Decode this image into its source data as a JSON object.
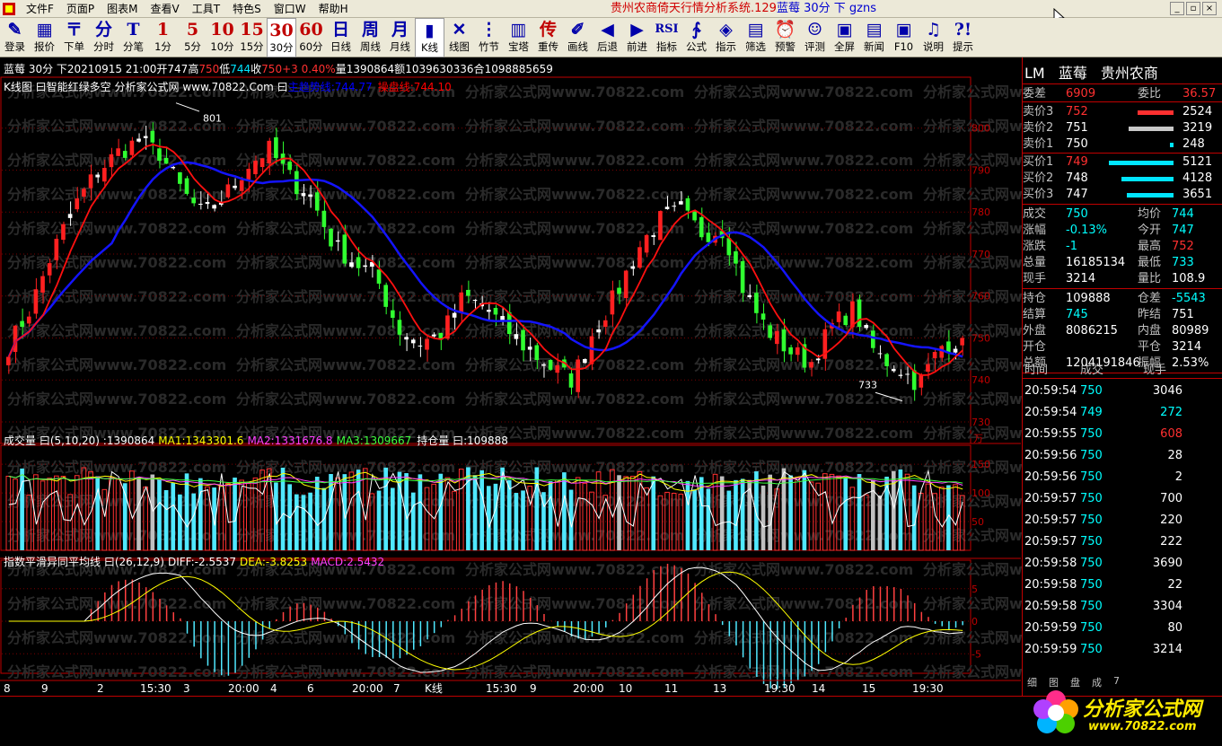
{
  "menubar": {
    "items": [
      "文件F",
      "页面P",
      "图表M",
      "查看V",
      "工具T",
      "特色S",
      "窗口W",
      "帮助H"
    ],
    "title_red": "贵州农商倚天行情分析系统.129",
    "title_blue": "蓝莓 30分 下 gzns"
  },
  "toolbar": [
    {
      "icon": "✎",
      "label": "登录",
      "name": "login"
    },
    {
      "icon": "▦",
      "label": "报价",
      "name": "quote"
    },
    {
      "icon": "〒",
      "label": "下单",
      "name": "order"
    },
    {
      "icon": "分",
      "label": "分时",
      "name": "intraday"
    },
    {
      "icon": "T",
      "label": "分笔",
      "name": "tick"
    },
    {
      "icon": "1",
      "label": "1分",
      "name": "1min"
    },
    {
      "icon": "5",
      "label": "5分",
      "name": "5min"
    },
    {
      "icon": "10",
      "label": "10分",
      "name": "10min"
    },
    {
      "icon": "15",
      "label": "15分",
      "name": "15min"
    },
    {
      "icon": "30",
      "label": "30分",
      "name": "30min",
      "selected": true
    },
    {
      "icon": "60",
      "label": "60分",
      "name": "60min"
    },
    {
      "icon": "日",
      "label": "日线",
      "name": "daily"
    },
    {
      "icon": "周",
      "label": "周线",
      "name": "weekly"
    },
    {
      "icon": "月",
      "label": "月线",
      "name": "monthly"
    },
    {
      "icon": "▮",
      "label": "K线",
      "name": "kline",
      "selected": true
    },
    {
      "icon": "✕",
      "label": "线图",
      "name": "line-chart"
    },
    {
      "icon": "⋮",
      "label": "竹节",
      "name": "bamboo"
    },
    {
      "icon": "▥",
      "label": "宝塔",
      "name": "tower"
    },
    {
      "icon": "传",
      "label": "重传",
      "name": "resend"
    },
    {
      "icon": "✐",
      "label": "画线",
      "name": "draw"
    },
    {
      "icon": "◀",
      "label": "后退",
      "name": "back"
    },
    {
      "icon": "▶",
      "label": "前进",
      "name": "forward"
    },
    {
      "icon": "RSI",
      "label": "指标",
      "name": "indicator"
    },
    {
      "icon": "∱",
      "label": "公式",
      "name": "formula"
    },
    {
      "icon": "◈",
      "label": "指示",
      "name": "signal"
    },
    {
      "icon": "▤",
      "label": "筛选",
      "name": "filter"
    },
    {
      "icon": "⏰",
      "label": "预警",
      "name": "alert"
    },
    {
      "icon": "☺",
      "label": "评测",
      "name": "evaluate"
    },
    {
      "icon": "▣",
      "label": "全屏",
      "name": "fullscreen"
    },
    {
      "icon": "▤",
      "label": "新闻",
      "name": "news"
    },
    {
      "icon": "▣",
      "label": "F10",
      "name": "f10"
    },
    {
      "icon": "♫",
      "label": "说明",
      "name": "manual"
    },
    {
      "icon": "?!",
      "label": "提示",
      "name": "tips"
    }
  ],
  "info_line": {
    "symbol": "蓝莓 30分 下",
    "datetime": "20210915 21:00",
    "open_label": "开",
    "open": "747",
    "high_label": "高",
    "high": "750",
    "low_label": "低",
    "low": "744",
    "close_label": "收",
    "close": "750",
    "change": "+3 0.40%",
    "vol_label": "量",
    "vol": "1390864",
    "amount_label": "额",
    "amount": "1039630336",
    "oi_label": "合",
    "oi": "109888",
    "extra": "5659"
  },
  "kline_panel": {
    "title": "K线图 曰智能红绿多空 分析家公式网 www.70822.Com 曰",
    "ma_blue_label": "主趋势线:744.77",
    "ma_red_label": "操盘线:744.10",
    "high_mark": "801",
    "low_mark": "733",
    "watermark": "分析家公式网www.70822.com"
  },
  "volume_panel": {
    "title": "成交量 曰(5,10,20) :1390864",
    "ma1": "MA1:1343301.6",
    "ma2": "MA2:1331676.8",
    "ma3": "MA3:1309667",
    "oi": "持仓量 曰:109888",
    "unit": "万"
  },
  "macd_panel": {
    "title": "指数平滑异同平均线 曰(26,12,9)",
    "diff": "DIFF:-2.5537",
    "dea": "DEA:-3.8253",
    "macd": "MACD:2.5432"
  },
  "x_axis": [
    "8",
    "9",
    "2",
    "15:30",
    "3",
    "20:00",
    "4",
    "6",
    "20:00",
    "7",
    "K线",
    "15:30",
    "9",
    "20:00",
    "10",
    "11",
    "13",
    "19:30",
    "14",
    "15",
    "19:30"
  ],
  "chart_data": [
    {
      "type": "candlestick",
      "ylim": [
        727,
        810
      ],
      "yticks": [
        730,
        740,
        750,
        760,
        770,
        780,
        790,
        800
      ],
      "series": [
        {
          "name": "主趋势线",
          "color": "#0000ff",
          "value": 744.77
        },
        {
          "name": "操盘线",
          "color": "#ff0000",
          "value": 744.1
        }
      ],
      "close_anchors": [
        748,
        757,
        770,
        781,
        789,
        794,
        797,
        794,
        785,
        779,
        784,
        791,
        795,
        788,
        783,
        772,
        768,
        764,
        752,
        749,
        751,
        760,
        757,
        752,
        747,
        743,
        740,
        752,
        760,
        771,
        778,
        780,
        775,
        776,
        760,
        752,
        747,
        744,
        753,
        757,
        746,
        743,
        739,
        748,
        750
      ]
    },
    {
      "type": "bar",
      "ylim": [
        0,
        180
      ],
      "yticks": [
        50,
        100,
        150
      ],
      "unit": "万",
      "series": [
        {
          "name": "成交量",
          "last": 1390864
        },
        {
          "name": "MA1",
          "last": 1343301.6
        },
        {
          "name": "MA2",
          "last": 1331676.8
        },
        {
          "name": "MA3",
          "last": 1309667
        },
        {
          "name": "持仓量",
          "last": 109888
        }
      ]
    },
    {
      "type": "bar",
      "ylim": [
        -8,
        8
      ],
      "yticks": [
        5,
        0,
        -5
      ],
      "series": [
        {
          "name": "DIFF",
          "last": -2.5537
        },
        {
          "name": "DEA",
          "last": -3.8253
        },
        {
          "name": "MACD",
          "last": 2.5432
        }
      ]
    }
  ],
  "right_panel": {
    "title": [
      "LM",
      "蓝莓",
      "贵州农商"
    ],
    "weicha": {
      "l1": "委差",
      "v1": "6909",
      "l2": "委比",
      "v2": "36.57"
    },
    "sells": [
      {
        "label": "卖价3",
        "price": "752",
        "vol": "2524",
        "bar": 0.55
      },
      {
        "label": "卖价2",
        "price": "751",
        "vol": "3219",
        "bar": 0.7
      },
      {
        "label": "卖价1",
        "price": "750",
        "vol": "248",
        "bar": 0.05
      }
    ],
    "buys": [
      {
        "label": "买价1",
        "price": "749",
        "vol": "5121",
        "bar": 1.0
      },
      {
        "label": "买价2",
        "price": "748",
        "vol": "4128",
        "bar": 0.8
      },
      {
        "label": "买价3",
        "price": "747",
        "vol": "3651",
        "bar": 0.72
      }
    ],
    "stats": [
      {
        "l1": "成交",
        "v1": "750",
        "c1": "#00ffff",
        "l2": "均价",
        "v2": "744",
        "c2": "#00ffff"
      },
      {
        "l1": "涨幅",
        "v1": "-0.13%",
        "c1": "#00ffff",
        "l2": "今开",
        "v2": "747",
        "c2": "#00ffff"
      },
      {
        "l1": "涨跌",
        "v1": "-1",
        "c1": "#00ffff",
        "l2": "最高",
        "v2": "752",
        "c2": "#ff3030"
      },
      {
        "l1": "总量",
        "v1": "16185134",
        "c1": "#ffffff",
        "l2": "最低",
        "v2": "733",
        "c2": "#00ffff"
      },
      {
        "l1": "现手",
        "v1": "3214",
        "c1": "#ffffff",
        "l2": "量比",
        "v2": "108.9",
        "c2": "#ffffff"
      }
    ],
    "stats2": [
      {
        "l1": "持仓",
        "v1": "109888",
        "c1": "#ffffff",
        "l2": "仓差",
        "v2": "-5543",
        "c2": "#00ffff"
      },
      {
        "l1": "结算",
        "v1": "745",
        "c1": "#00ffff",
        "l2": "昨结",
        "v2": "751",
        "c2": "#ffffff"
      },
      {
        "l1": "外盘",
        "v1": "8086215",
        "c1": "#ffffff",
        "l2": "内盘",
        "v2": "80989",
        "c2": "#ffffff"
      },
      {
        "l1": "开仓",
        "v1": "",
        "c1": "#ffffff",
        "l2": "平仓",
        "v2": "3214",
        "c2": "#ffffff"
      },
      {
        "l1": "总额",
        "v1": "1204191846",
        "c1": "#ffffff",
        "l2": "振幅",
        "v2": "2.53%",
        "c2": "#ffffff"
      }
    ],
    "ticks_head": {
      "time": "时间",
      "deal": "成交",
      "vol": "现手"
    },
    "ticks": [
      {
        "t": "20:59:54",
        "p": "750",
        "pc": "#00ffff",
        "v": "3046",
        "vc": "#ffffff"
      },
      {
        "t": "20:59:54",
        "p": "749",
        "pc": "#00ffff",
        "v": "272",
        "vc": "#00ffff"
      },
      {
        "t": "20:59:55",
        "p": "750",
        "pc": "#00ffff",
        "v": "608",
        "vc": "#ff3030"
      },
      {
        "t": "20:59:56",
        "p": "750",
        "pc": "#00ffff",
        "v": "28",
        "vc": "#ffffff"
      },
      {
        "t": "20:59:56",
        "p": "750",
        "pc": "#00ffff",
        "v": "2",
        "vc": "#ffffff"
      },
      {
        "t": "20:59:57",
        "p": "750",
        "pc": "#00ffff",
        "v": "700",
        "vc": "#ffffff"
      },
      {
        "t": "20:59:57",
        "p": "750",
        "pc": "#00ffff",
        "v": "220",
        "vc": "#ffffff"
      },
      {
        "t": "20:59:57",
        "p": "750",
        "pc": "#00ffff",
        "v": "222",
        "vc": "#ffffff"
      },
      {
        "t": "20:59:58",
        "p": "750",
        "pc": "#00ffff",
        "v": "3690",
        "vc": "#ffffff"
      },
      {
        "t": "20:59:58",
        "p": "750",
        "pc": "#00ffff",
        "v": "22",
        "vc": "#ffffff"
      },
      {
        "t": "20:59:58",
        "p": "750",
        "pc": "#00ffff",
        "v": "3304",
        "vc": "#ffffff"
      },
      {
        "t": "20:59:59",
        "p": "750",
        "pc": "#00ffff",
        "v": "80",
        "vc": "#ffffff"
      },
      {
        "t": "20:59:59",
        "p": "750",
        "pc": "#00ffff",
        "v": "3214",
        "vc": "#ffffff"
      }
    ],
    "tabs": [
      "细",
      "图",
      "盘",
      "成",
      "7"
    ]
  },
  "logo": {
    "name": "分析家公式网",
    "url": "www.70822.com"
  }
}
